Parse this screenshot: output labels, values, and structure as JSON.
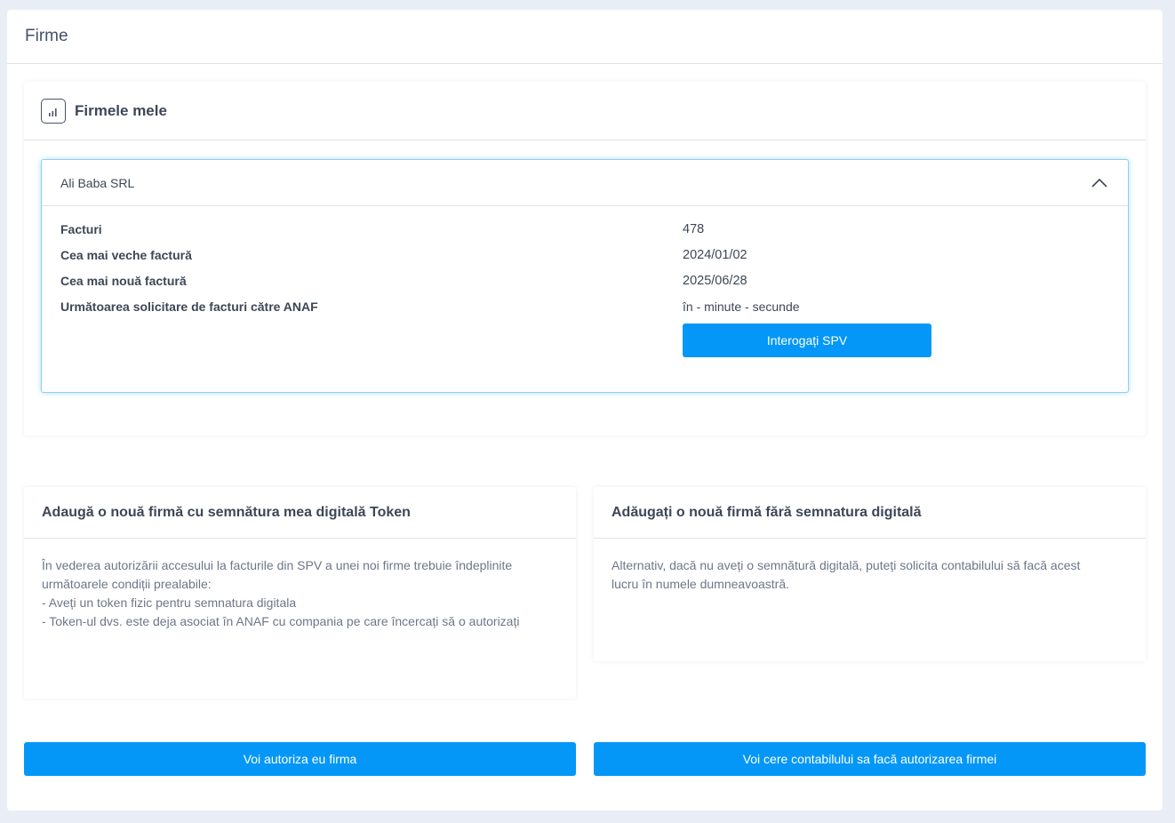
{
  "page": {
    "title": "Firme"
  },
  "firms_section": {
    "title": "Firmele mele",
    "icon": "bar-chart-icon"
  },
  "company": {
    "name": "Ali Baba SRL",
    "toggle_icon": "chevron-up-icon",
    "details": [
      {
        "label": "Facturi",
        "value": "478"
      },
      {
        "label": "Cea mai veche factură",
        "value": "2024/01/02"
      },
      {
        "label": "Cea mai nouă factură",
        "value": "2025/06/28"
      },
      {
        "label": "Următoarea solicitare de facturi către ANAF",
        "value": "în - minute - secunde"
      }
    ],
    "spv_button": "Interogați SPV"
  },
  "add_token": {
    "title": "Adaugă o nouă firmă cu semnătura mea digitală Token",
    "lines": [
      "În vederea autorizării accesului la facturile din SPV a unei noi firme trebuie îndeplinite",
      "următoarele condiții prealabile:",
      "- Aveți un token fizic pentru semnatura digitala",
      "- Token-ul dvs. este deja asociat în ANAF cu compania pe care încercați să o autorizați"
    ]
  },
  "add_no_signature": {
    "title": "Adăugați o nouă firmă fără semnatura digitală",
    "lines": [
      "Alternativ, dacă nu aveți o semnătură digitală, puteți solicita contabilului să facă acest",
      "lucru în numele dumneavoastră."
    ]
  },
  "buttons": {
    "authorize_self": "Voi autoriza eu firma",
    "ask_accountant": "Voi cere contabilului sa facă autorizarea firmei"
  },
  "colors": {
    "accent": "#0497f7",
    "background": "#e9eef6",
    "panel_highlight": "#8fd0ee"
  }
}
